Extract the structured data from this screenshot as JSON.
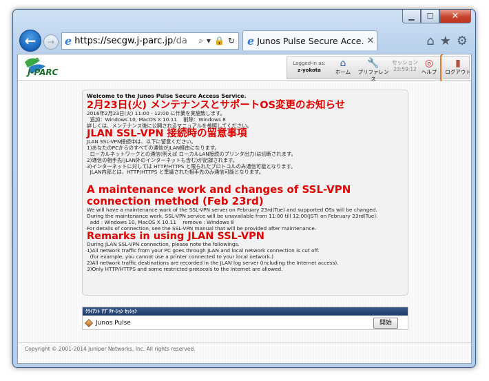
{
  "browser": {
    "url_host": "https://secgw.j-parc.jp",
    "url_rest": "/da",
    "tab_title": "Junos Pulse Secure Acce...",
    "window_controls": {
      "minimize": "▁",
      "maximize": "☐",
      "close": "✕"
    },
    "nav_back": "←",
    "nav_forward": "→",
    "addr_tools": [
      "⌕",
      "▾",
      "🔒",
      "↻"
    ],
    "tab_close": "✕",
    "right_icons": [
      "⌂",
      "★",
      "⚙"
    ]
  },
  "header": {
    "logo_text": "J-PARC",
    "logged_in_label": "Logged-in as:",
    "logged_in_user": "z-yokota",
    "home_label": "ホーム",
    "prefs_label": "プリファレンス",
    "session_label": "セッション",
    "session_time": "23:59:12",
    "help_label": "ヘルプ",
    "logout_label": "ログアウト",
    "icons": {
      "home": "⌂",
      "prefs": "🔧",
      "help": "◎",
      "logout": "▮"
    }
  },
  "notice": {
    "welcome": "Welcome to the Junos Pulse Secure Access Service.",
    "jp_heading1": "2月23日(火) メンテナンスとサポートOS変更のお知らせ",
    "jp_body1": "2016年2月23日(火) 11:00 - 12:00 に作業を実施致します。\n  追加：Windows 10, MacOS X 10.11    削除：Windows 8\n詳しくは、メンテナンス後に公開されるマニュアルを参照してください。",
    "jp_heading2": "JLAN SSL-VPN 接続時の留意事項",
    "jp_body2": "JLAN SSL-VPN接続中は、以下に留意ください。\n1)あなたのPCからのすべての通信がJLAN経由になります。\n  ローカルネットワークとの通信(例えば ローカルLAN接続のプリンタ出力)は切断されます。\n2)通信の相手先(JLAN外のインターネットも含む)が記録されます。\n3)インターネットに対しては HTTP/HTTPS と限られたプロトコルのみ通信可能となります。\n  JLAN内部とは、HTTP/HTTPS と準議された相手先のみ通信可能となります。",
    "en_heading1": "A maintenance work and changes of SSL-VPN connection method (Feb 23rd)",
    "en_body1": "We will have a maintenance work of the SSL-VPN server on February 23rd(Tue) and supported OSs will be changed.\nDuring the maintenance work, SSL-VPN service will be unavailable from 11:00 till 12:00(JST) on February 23rd(Tue).\n  add : Windows 10, MacOS X 10.11    remove : Windows 8\nFor details of connection, see the SSL-VPN manual that will be provided after maintenance.",
    "en_heading2": "Remarks in using JLAN SSL-VPN",
    "en_body2": "During JLAN SSL-VPN connection, please note the followings.\n1)All network traffic from your PC goes through JLAN and local network connection is cut off.\n  (for example, you cannot use a printer connected to your local network.)\n2)All network traffic destinations are recorded in the JLAN log server (Including the Internet access).\n3)Only HTTP/HTTPS and some restricted protocols to the Internet are allowed."
  },
  "client_panel": {
    "bar_title": "ｸﾗｲｱﾝﾄ ｱﾌﾟﾘｹｰｼｮﾝ ｾｯｼｮﾝ",
    "app_name": "Junos Pulse",
    "start_button": "開始"
  },
  "footer": {
    "copyright": "Copyright © 2001-2014 Juniper Networks, Inc. All rights reserved."
  }
}
